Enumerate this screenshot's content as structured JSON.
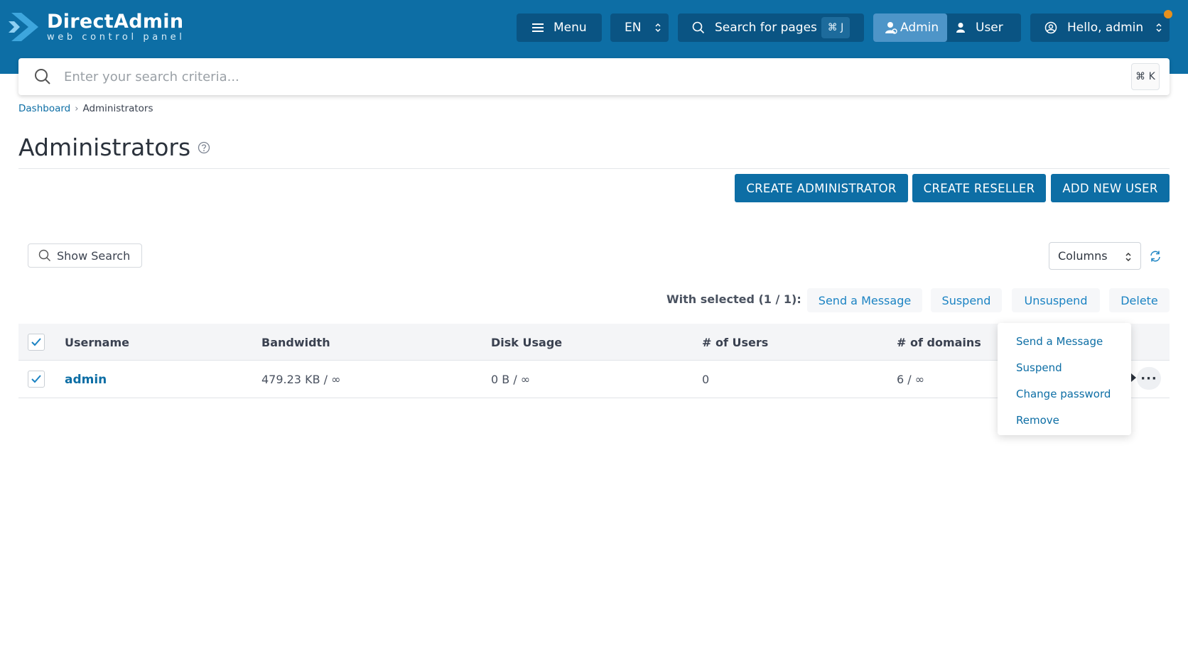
{
  "brand": {
    "title": "DirectAdmin",
    "subtitle": "web control panel"
  },
  "header": {
    "menu_label": "Menu",
    "language": "EN",
    "search_pages_label": "Search for pages",
    "search_shortcut": "⌘ J",
    "mode_admin": "Admin",
    "mode_user": "User",
    "greeting": "Hello, admin"
  },
  "search": {
    "placeholder": "Enter your search criteria...",
    "shortcut": "⌘ K"
  },
  "breadcrumb": {
    "home": "Dashboard",
    "current": "Administrators"
  },
  "page": {
    "title": "Administrators"
  },
  "actions": {
    "create_admin": "CREATE ADMINISTRATOR",
    "create_reseller": "CREATE RESELLER",
    "add_user": "ADD NEW USER"
  },
  "toolbar": {
    "show_search": "Show Search",
    "columns": "Columns",
    "with_selected": "With selected (1 / 1):",
    "send_message": "Send a Message",
    "suspend": "Suspend",
    "unsuspend": "Unsuspend",
    "delete": "Delete"
  },
  "table": {
    "headers": [
      "Username",
      "Bandwidth",
      "Disk Usage",
      "# of Users",
      "# of domains"
    ],
    "rows": [
      {
        "username": "admin",
        "bandwidth": "479.23 KB / ∞",
        "disk": "0 B / ∞",
        "users": "0",
        "domains": "6 / ∞"
      }
    ]
  },
  "row_menu": {
    "items": [
      "Send a Message",
      "Suspend",
      "Change password",
      "Remove"
    ]
  },
  "colors": {
    "brand_blue": "#0d6ea5",
    "header_dark": "#0a5483",
    "accent_orange": "#e8901c"
  }
}
